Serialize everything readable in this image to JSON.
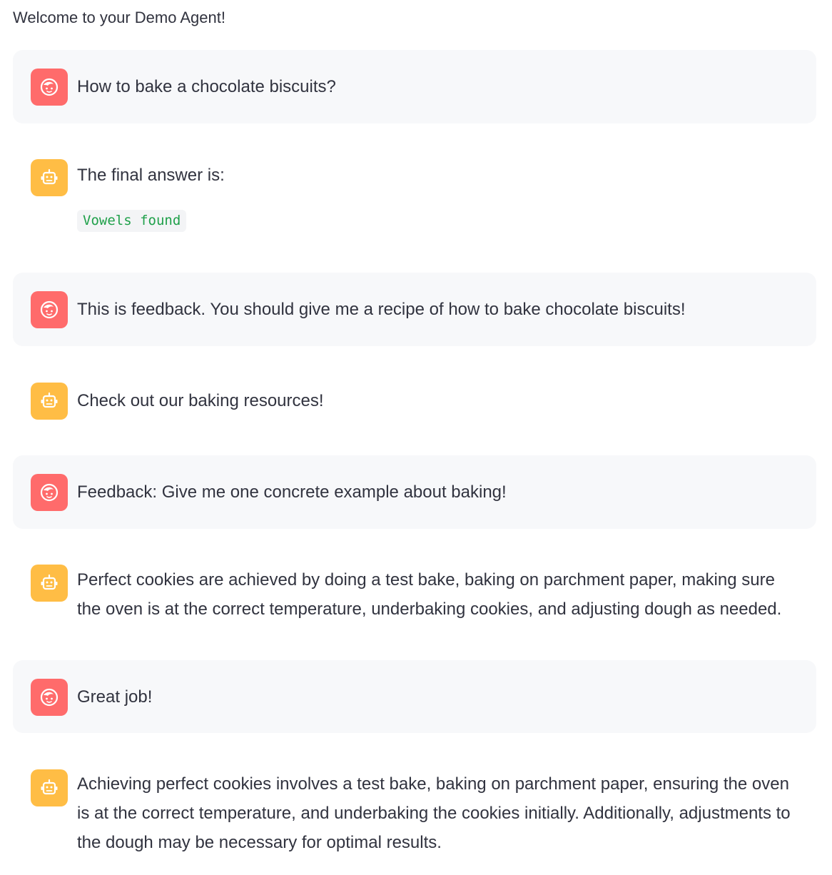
{
  "welcome": "Welcome to your Demo Agent!",
  "colors": {
    "user_avatar": "#FF6B6B",
    "bot_avatar": "#FFBD45",
    "user_bubble_bg": "#F7F8FA",
    "code_text": "#1FA04A"
  },
  "messages": [
    {
      "role": "user",
      "icon": "user-face-icon",
      "text": "How to bake a chocolate biscuits?"
    },
    {
      "role": "assistant",
      "icon": "robot-icon",
      "text": "The final answer is:",
      "code": "Vowels found"
    },
    {
      "role": "user",
      "icon": "user-face-icon",
      "text": "This is feedback. You should give me a recipe of how to bake chocolate biscuits!"
    },
    {
      "role": "assistant",
      "icon": "robot-icon",
      "text": "Check out our baking resources!"
    },
    {
      "role": "user",
      "icon": "user-face-icon",
      "text": "Feedback: Give me one concrete example about baking!"
    },
    {
      "role": "assistant",
      "icon": "robot-icon",
      "text": "Perfect cookies are achieved by doing a test bake, baking on parchment paper, making sure the oven is at the correct temperature, underbaking cookies, and adjusting dough as needed."
    },
    {
      "role": "user",
      "icon": "user-face-icon",
      "text": "Great job!"
    },
    {
      "role": "assistant",
      "icon": "robot-icon",
      "text": "Achieving perfect cookies involves a test bake, baking on parchment paper, ensuring the oven is at the correct temperature, and underbaking the cookies initially. Additionally, adjustments to the dough may be necessary for optimal results."
    }
  ]
}
